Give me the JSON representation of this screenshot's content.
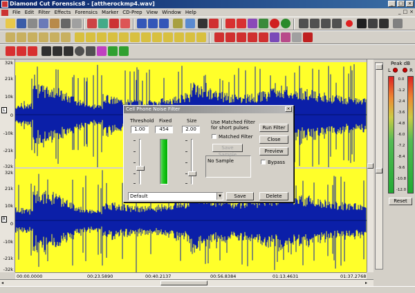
{
  "window": {
    "title": "Diamond Cut Forensics8 - [attherockmp4.wav]",
    "minimize": "_",
    "maximize": "□",
    "close": "×"
  },
  "menu": {
    "items": [
      "File",
      "Edit",
      "Filter",
      "Effects",
      "Forensics",
      "Marker",
      "CD-Prep",
      "View",
      "Window",
      "Help"
    ],
    "right_controls": [
      "_",
      "□",
      "×"
    ]
  },
  "waveform": {
    "left_ruler_top": [
      "32k",
      "21k",
      "10k",
      "0",
      "-10k",
      "-21k",
      "-32k"
    ],
    "left_ruler_bottom": [
      "32k",
      "21k",
      "10k",
      "0",
      "-10k",
      "-21k",
      "-32k"
    ],
    "channel_left_label": "L",
    "channel_right_label": "R",
    "background_color": "#ffff2a",
    "wave_color": "#0b1fa8",
    "timeline": [
      "00:00.0000",
      "00:23.5890",
      "00:40.2137",
      "00:56.8384",
      "01:13.4631",
      "01:37.2768"
    ]
  },
  "meter": {
    "title": "Peak dB",
    "left_label": "L",
    "right_label": "R",
    "db_marks": [
      "0.0",
      "-1.2",
      "-2.4",
      "-3.6",
      "-4.8",
      "-6.0",
      "-7.2",
      "-8.4",
      "-9.6",
      "-10.8",
      "-12.0"
    ],
    "reset_label": "Reset"
  },
  "dialog": {
    "title": "Cell Phone Noise Filter",
    "close": "×",
    "threshold_label": "Threshold",
    "threshold_value": "1.00",
    "fixed_label": "Fixed",
    "fixed_value": "454",
    "size_label": "Size",
    "size_value": "2.00",
    "matched_desc": "Use Matched filter for short pulses",
    "matched_filter_label": "Matched Filter",
    "save_sample_label": "Save Sample",
    "no_sample_text": "No Sample",
    "run_filter_label": "Run Filter",
    "close_label": "Close",
    "preview_label": "Preview",
    "bypass_label": "Bypass",
    "preset_value": "Default",
    "save_label": "Save",
    "delete_label": "Delete"
  }
}
